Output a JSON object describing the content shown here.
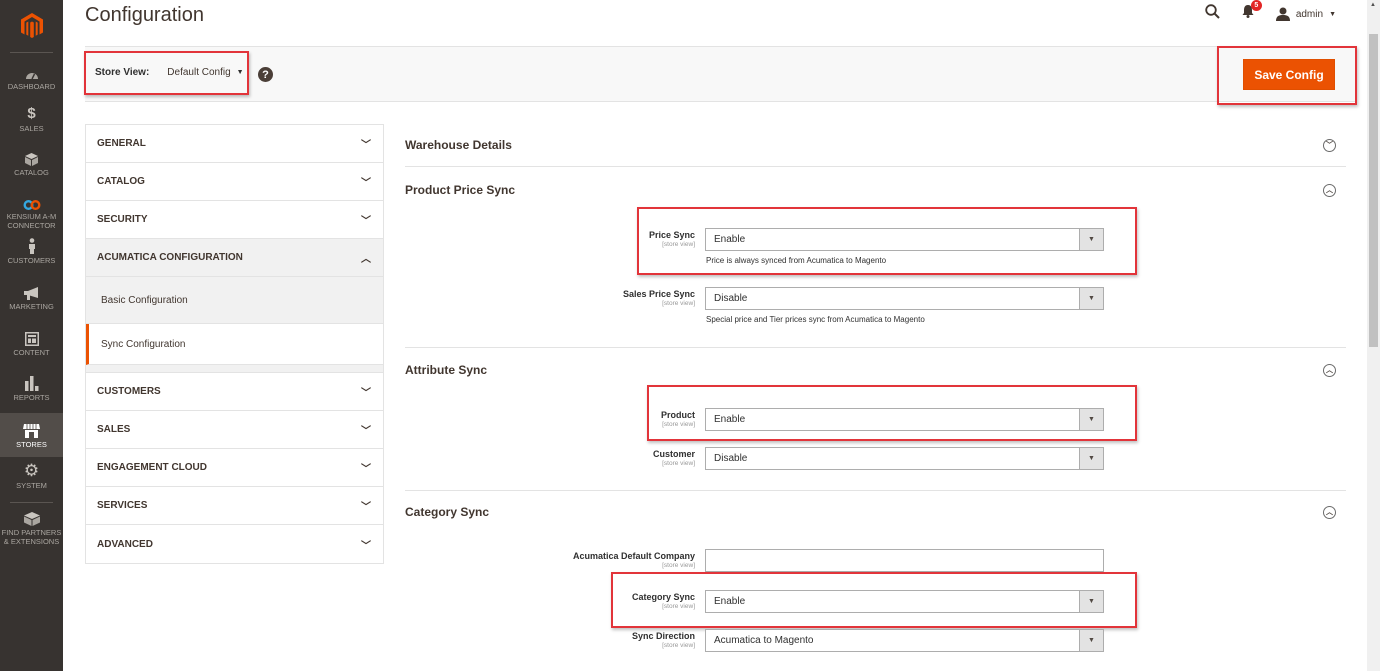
{
  "sidebar": {
    "items": [
      {
        "label": "DASHBOARD",
        "icon": "dashboard-icon"
      },
      {
        "label": "SALES",
        "icon": "dollar-icon"
      },
      {
        "label": "CATALOG",
        "icon": "box-icon"
      },
      {
        "label": "KENSIUM A-M CONNECTOR",
        "icon": "connector-icon"
      },
      {
        "label": "CUSTOMERS",
        "icon": "person-icon"
      },
      {
        "label": "MARKETING",
        "icon": "megaphone-icon"
      },
      {
        "label": "CONTENT",
        "icon": "layout-icon"
      },
      {
        "label": "REPORTS",
        "icon": "bar-chart-icon"
      },
      {
        "label": "STORES",
        "icon": "storefront-icon",
        "active": true
      },
      {
        "label": "SYSTEM",
        "icon": "gear-icon"
      },
      {
        "label": "FIND PARTNERS & EXTENSIONS",
        "icon": "blocks-icon"
      }
    ]
  },
  "header": {
    "title": "Configuration",
    "notifications_count": "5",
    "user": "admin"
  },
  "toolbar": {
    "store_view_label": "Store View:",
    "store_view_value": "Default Config",
    "help": "?",
    "save_label": "Save Config"
  },
  "config_nav": {
    "tabs": [
      {
        "label": "GENERAL"
      },
      {
        "label": "CATALOG"
      },
      {
        "label": "SECURITY"
      },
      {
        "label": "ACUMATICA CONFIGURATION",
        "open": true,
        "children": [
          {
            "label": "Basic Configuration"
          },
          {
            "label": "Sync Configuration",
            "active": true
          }
        ]
      },
      {
        "label": "CUSTOMERS"
      },
      {
        "label": "SALES"
      },
      {
        "label": "ENGAGEMENT CLOUD"
      },
      {
        "label": "SERVICES"
      },
      {
        "label": "ADVANCED"
      }
    ]
  },
  "sections": {
    "warehouse": {
      "title": "Warehouse Details"
    },
    "price": {
      "title": "Product Price Sync",
      "fields": [
        {
          "label": "Price Sync",
          "scope": "[store view]",
          "value": "Enable",
          "note": "Price is always synced from Acumatica to Magento"
        },
        {
          "label": "Sales Price Sync",
          "scope": "[store view]",
          "value": "Disable",
          "note": "Special price and Tier prices sync from Acumatica to Magento"
        }
      ]
    },
    "attribute": {
      "title": "Attribute Sync",
      "fields": [
        {
          "label": "Product",
          "scope": "[store view]",
          "value": "Enable"
        },
        {
          "label": "Customer",
          "scope": "[store view]",
          "value": "Disable"
        }
      ]
    },
    "category": {
      "title": "Category Sync",
      "fields": [
        {
          "label": "Acumatica Default Company",
          "scope": "[store view]",
          "value": ""
        },
        {
          "label": "Category Sync",
          "scope": "[store view]",
          "value": "Enable"
        },
        {
          "label": "Sync Direction",
          "scope": "[store view]",
          "value": "Acumatica to Magento"
        }
      ]
    }
  },
  "colors": {
    "accent": "#eb5202",
    "highlight": "#e2343a",
    "nav_bg": "#373330"
  }
}
